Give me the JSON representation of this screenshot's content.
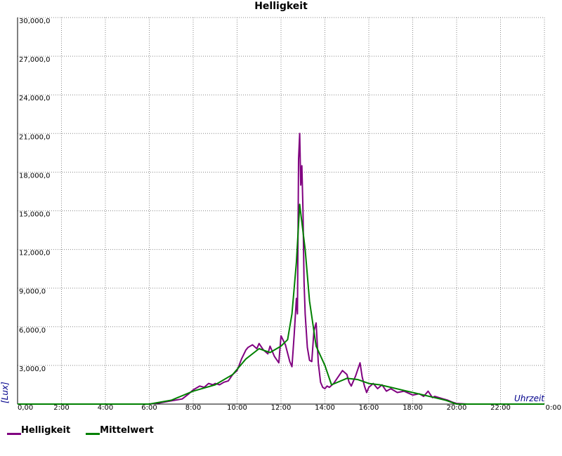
{
  "chart_data": {
    "type": "line",
    "title": "Helligkeit",
    "xlabel": "Uhrzeit",
    "ylabel": "[Lux]",
    "xlim": [
      0,
      24
    ],
    "ylim": [
      0,
      30000
    ],
    "grid": true,
    "legend_position": "bottom-left",
    "x_ticks": [
      "0,00",
      "2:00",
      "4:00",
      "6:00",
      "8:00",
      "10:00",
      "12:00",
      "14:00",
      "16:00",
      "18:00",
      "20:00",
      "22:00",
      "0:00"
    ],
    "y_ticks": [
      "3,000,0",
      "6,000,0",
      "9,000,0",
      "12,000,0",
      "15,000,0",
      "18,000,0",
      "21,000,0",
      "24,000,0",
      "27,000,0",
      "30,000,0"
    ],
    "colors": {
      "helligkeit": "#800080",
      "mittelwert": "#008000",
      "axis_label": "#00008b"
    },
    "series": [
      {
        "name": "Helligkeit",
        "color": "#800080",
        "x": [
          0,
          6.0,
          6.5,
          7.0,
          7.5,
          7.8,
          8.0,
          8.3,
          8.5,
          8.7,
          8.9,
          9.0,
          9.2,
          9.4,
          9.6,
          9.8,
          10.0,
          10.2,
          10.4,
          10.5,
          10.7,
          10.9,
          11.0,
          11.2,
          11.4,
          11.5,
          11.7,
          11.9,
          12.0,
          12.2,
          12.4,
          12.5,
          12.6,
          12.7,
          12.75,
          12.8,
          12.85,
          12.9,
          12.95,
          13.0,
          13.05,
          13.1,
          13.2,
          13.3,
          13.4,
          13.5,
          13.6,
          13.7,
          13.8,
          13.9,
          14.0,
          14.1,
          14.2,
          14.4,
          14.6,
          14.8,
          15.0,
          15.1,
          15.2,
          15.4,
          15.6,
          15.7,
          15.8,
          15.9,
          16.0,
          16.2,
          16.4,
          16.6,
          16.8,
          17.0,
          17.3,
          17.6,
          18.0,
          18.3,
          18.5,
          18.7,
          18.9,
          19.0,
          19.2,
          19.4,
          19.6,
          19.8,
          20.0,
          20.5,
          21.0,
          24.0
        ],
        "y": [
          0,
          0,
          100,
          250,
          400,
          800,
          1100,
          1400,
          1300,
          1600,
          1500,
          1600,
          1500,
          1700,
          1800,
          2300,
          2600,
          3500,
          4200,
          4400,
          4600,
          4300,
          4700,
          4200,
          3900,
          4500,
          3700,
          3200,
          5300,
          4600,
          3300,
          2900,
          5400,
          8200,
          7000,
          19000,
          21000,
          17000,
          18500,
          15000,
          9500,
          7000,
          4400,
          3400,
          3300,
          5700,
          6300,
          3200,
          1700,
          1300,
          1200,
          1400,
          1300,
          1600,
          2100,
          2600,
          2300,
          1700,
          1400,
          2200,
          3200,
          2100,
          1400,
          900,
          1300,
          1600,
          1200,
          1500,
          1000,
          1200,
          900,
          1000,
          700,
          800,
          600,
          1000,
          500,
          600,
          500,
          400,
          300,
          150,
          50,
          0,
          0,
          0
        ]
      },
      {
        "name": "Mittelwert",
        "color": "#008000",
        "x": [
          0,
          6.0,
          7.0,
          8.0,
          9.0,
          9.8,
          10.4,
          11.0,
          11.5,
          12.0,
          12.3,
          12.5,
          12.7,
          12.85,
          13.1,
          13.3,
          13.6,
          14.0,
          14.3,
          15.0,
          15.5,
          16.0,
          16.5,
          17.0,
          17.5,
          18.0,
          18.5,
          19.0,
          19.5,
          20.0,
          24.0
        ],
        "y": [
          0,
          0,
          300,
          1000,
          1500,
          2300,
          3500,
          4300,
          4000,
          4500,
          5000,
          7000,
          11000,
          15500,
          12000,
          8000,
          4500,
          3000,
          1500,
          2000,
          1900,
          1600,
          1500,
          1300,
          1100,
          900,
          700,
          500,
          300,
          0,
          0
        ]
      }
    ]
  }
}
